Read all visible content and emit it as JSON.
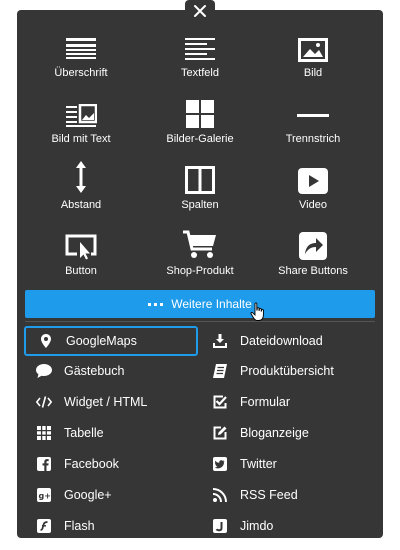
{
  "tiles": [
    {
      "label": "Überschrift",
      "icon": "heading-icon"
    },
    {
      "label": "Textfeld",
      "icon": "text-icon"
    },
    {
      "label": "Bild",
      "icon": "image-icon"
    },
    {
      "label": "Bild mit Text",
      "icon": "image-text-icon"
    },
    {
      "label": "Bilder-Galerie",
      "icon": "gallery-icon"
    },
    {
      "label": "Trennstrich",
      "icon": "divider-icon"
    },
    {
      "label": "Abstand",
      "icon": "spacing-icon"
    },
    {
      "label": "Spalten",
      "icon": "columns-icon"
    },
    {
      "label": "Video",
      "icon": "video-icon"
    },
    {
      "label": "Button",
      "icon": "button-icon"
    },
    {
      "label": "Shop-Produkt",
      "icon": "cart-icon"
    },
    {
      "label": "Share Buttons",
      "icon": "share-icon"
    }
  ],
  "more_button": {
    "label": "Weitere Inhalte"
  },
  "list_left": [
    {
      "label": "GoogleMaps",
      "icon": "map-pin-icon"
    },
    {
      "label": "Gästebuch",
      "icon": "speech-bubble-icon"
    },
    {
      "label": "Widget / HTML",
      "icon": "code-icon"
    },
    {
      "label": "Tabelle",
      "icon": "table-icon"
    },
    {
      "label": "Facebook",
      "icon": "facebook-icon"
    },
    {
      "label": "Google+",
      "icon": "google-plus-icon"
    },
    {
      "label": "Flash",
      "icon": "flash-icon"
    }
  ],
  "list_right": [
    {
      "label": "Dateidownload",
      "icon": "download-icon"
    },
    {
      "label": "Produktübersicht",
      "icon": "catalog-icon"
    },
    {
      "label": "Formular",
      "icon": "form-check-icon"
    },
    {
      "label": "Bloganzeige",
      "icon": "edit-box-icon"
    },
    {
      "label": "Twitter",
      "icon": "twitter-icon"
    },
    {
      "label": "RSS Feed",
      "icon": "rss-icon"
    },
    {
      "label": "Jimdo",
      "icon": "jimdo-icon"
    }
  ],
  "colors": {
    "panel": "#363636",
    "accent": "#1e9bea",
    "text": "#ffffff"
  }
}
